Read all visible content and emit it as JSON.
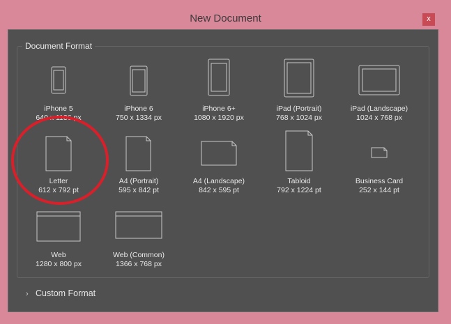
{
  "window": {
    "title": "New Document",
    "close_label": "x"
  },
  "group": {
    "label": "Document Format"
  },
  "presets": [
    {
      "name": "iPhone 5",
      "size": "640 x 1136 px",
      "icon": "phone-portrait-icon"
    },
    {
      "name": "iPhone 6",
      "size": "750 x 1334 px",
      "icon": "phone-portrait-icon"
    },
    {
      "name": "iPhone 6+",
      "size": "1080 x 1920 px",
      "icon": "phone-portrait-icon"
    },
    {
      "name": "iPad (Portrait)",
      "size": "768 x 1024 px",
      "icon": "tablet-portrait-icon"
    },
    {
      "name": "iPad (Landscape)",
      "size": "1024 x 768 px",
      "icon": "tablet-landscape-icon"
    },
    {
      "name": "Letter",
      "size": "612 x 792 pt",
      "icon": "page-portrait-icon"
    },
    {
      "name": "A4 (Portrait)",
      "size": "595 x 842 pt",
      "icon": "page-portrait-icon"
    },
    {
      "name": "A4 (Landscape)",
      "size": "842 x 595 pt",
      "icon": "page-landscape-icon"
    },
    {
      "name": "Tabloid",
      "size": "792 x 1224 pt",
      "icon": "page-portrait-icon"
    },
    {
      "name": "Business Card",
      "size": "252 x 144 pt",
      "icon": "card-icon"
    },
    {
      "name": "Web",
      "size": "1280 x 800 px",
      "icon": "browser-window-icon"
    },
    {
      "name": "Web (Common)",
      "size": "1366 x 768 px",
      "icon": "browser-window-icon"
    }
  ],
  "custom_format": {
    "label": "Custom Format",
    "icon": "chevron-right-icon"
  },
  "annotation": {
    "icon": "red-circle-highlight-icon",
    "color": "#d9202a"
  },
  "colors": {
    "frame": "#d9889a",
    "panel": "#505050",
    "close": "#c84a55",
    "text": "#e8e8e8"
  }
}
